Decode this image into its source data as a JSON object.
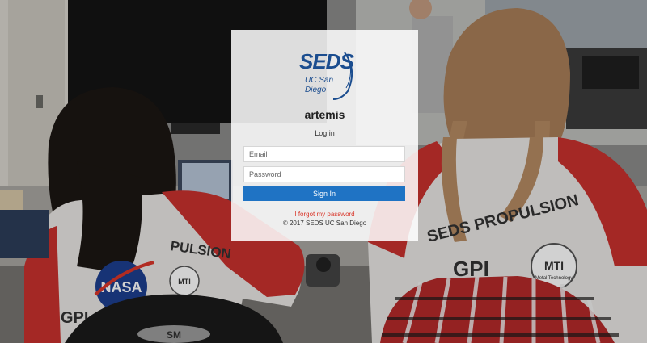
{
  "logo": {
    "main_text": "SEDS",
    "sub_text": "UC San Diego"
  },
  "login": {
    "title": "artemis",
    "subtitle": "Log in",
    "email_placeholder": "Email",
    "password_placeholder": "Password",
    "signin_label": "Sign In",
    "forgot_label": "I forgot my password",
    "copyright": "© 2017 SEDS UC San Diego"
  },
  "background": {
    "shirt_text_left": "SEDS PROPULSION",
    "shirt_text_right": "SEDS PROPULSION",
    "gpi_text": "GPI",
    "nasa_text": "NASA",
    "mti_text": "MTI",
    "mti_sub": "Metal Technology"
  },
  "colors": {
    "accent": "#1f73c4",
    "link": "#d9362a",
    "logo": "#1b4d8f",
    "shirt_red": "#c8312e"
  }
}
